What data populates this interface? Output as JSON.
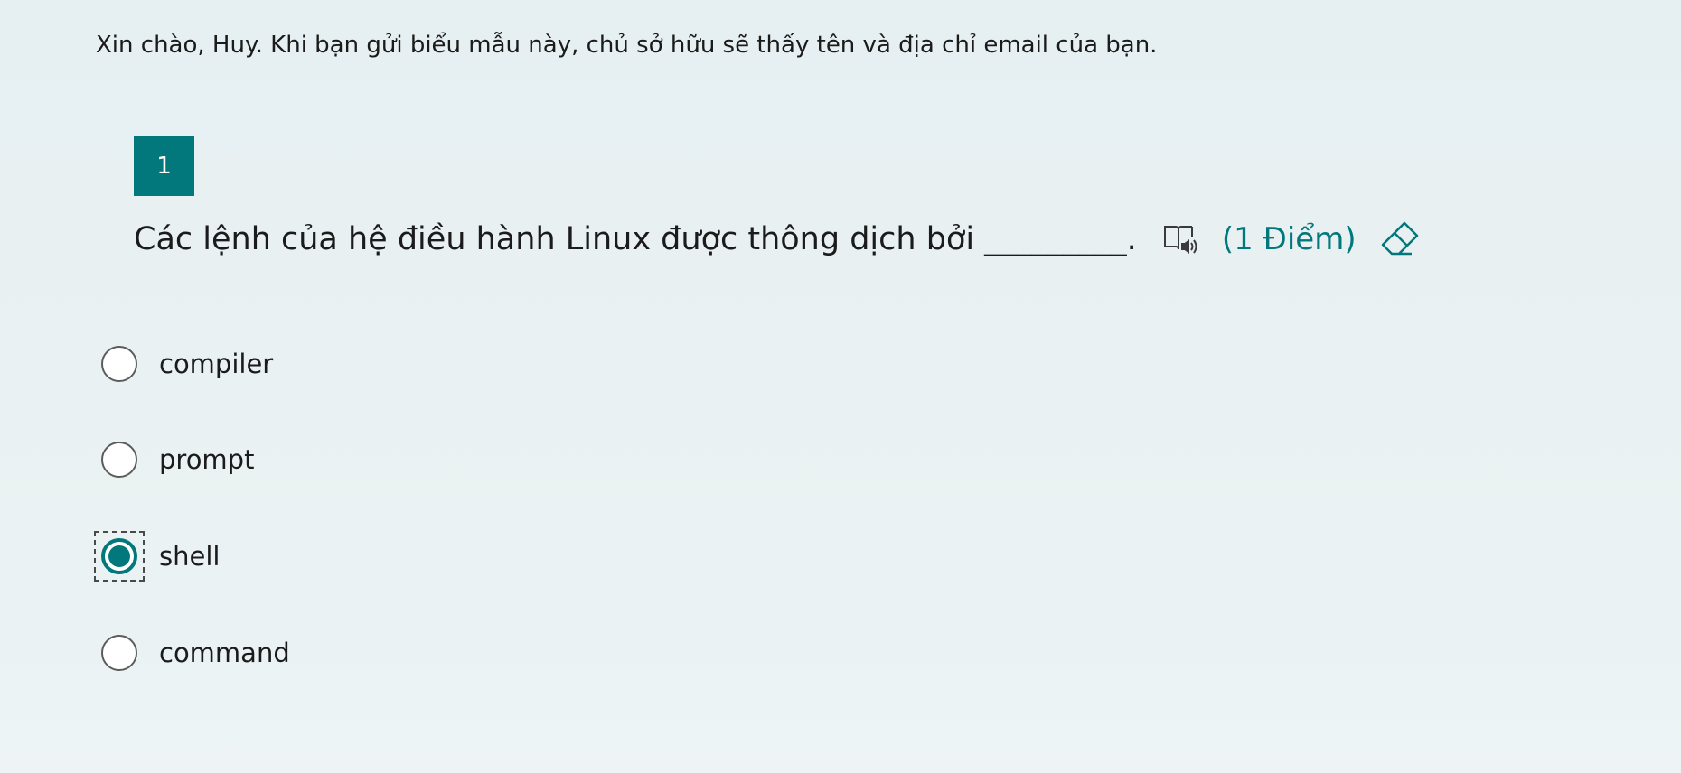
{
  "greeting": "Xin chào, Huy. Khi bạn gửi biểu mẫu này, chủ sở hữu sẽ thấy tên và địa chỉ email của bạn.",
  "question": {
    "number": "1",
    "text": "Các lệnh của hệ điều hành Linux được thông dịch bởi _________.",
    "points": "(1 Điểm)",
    "icons": {
      "reader": "immersive-reader-icon",
      "eraser": "eraser-icon"
    },
    "options": [
      {
        "label": "compiler",
        "checked": false
      },
      {
        "label": "prompt",
        "checked": false
      },
      {
        "label": "shell",
        "checked": true
      },
      {
        "label": "command",
        "checked": false
      }
    ]
  },
  "colors": {
    "accent": "#03787c",
    "text": "#1b1b1b",
    "background": "#e8f0f2"
  }
}
